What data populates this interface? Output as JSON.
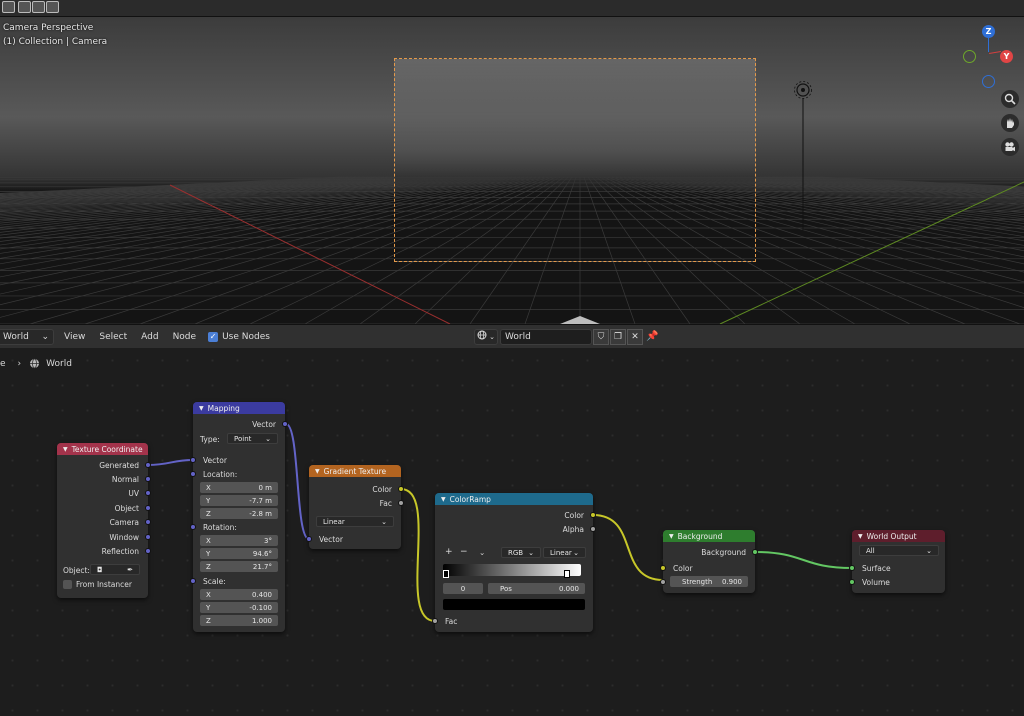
{
  "viewport": {
    "overlay_line1": "Camera Perspective",
    "overlay_line2": "(1) Collection | Camera",
    "gizmo": {
      "z": "Z",
      "y": "Y"
    }
  },
  "node_header": {
    "editor_type": "World",
    "menu": [
      "View",
      "Select",
      "Add",
      "Node"
    ],
    "use_nodes_label": "Use Nodes",
    "use_nodes_checked": true,
    "datablock_name": "World"
  },
  "breadcrumb": {
    "prefix": "e",
    "current": "World"
  },
  "nodes": {
    "texcoord": {
      "title": "Texture Coordinate",
      "outputs": [
        "Generated",
        "Normal",
        "UV",
        "Object",
        "Camera",
        "Window",
        "Reflection"
      ],
      "object_label": "Object:",
      "from_instancer": "From Instancer"
    },
    "mapping": {
      "title": "Mapping",
      "output": "Vector",
      "type_label": "Type:",
      "type_value": "Point",
      "vector_input": "Vector",
      "location_label": "Location:",
      "location": [
        {
          "axis": "X",
          "value": "0 m"
        },
        {
          "axis": "Y",
          "value": "-7.7 m"
        },
        {
          "axis": "Z",
          "value": "-2.8 m"
        }
      ],
      "rotation_label": "Rotation:",
      "rotation": [
        {
          "axis": "X",
          "value": "3°"
        },
        {
          "axis": "Y",
          "value": "94.6°"
        },
        {
          "axis": "Z",
          "value": "21.7°"
        }
      ],
      "scale_label": "Scale:",
      "scale": [
        {
          "axis": "X",
          "value": "0.400"
        },
        {
          "axis": "Y",
          "value": "-0.100"
        },
        {
          "axis": "Z",
          "value": "1.000"
        }
      ]
    },
    "gradient": {
      "title": "Gradient Texture",
      "out_color": "Color",
      "out_fac": "Fac",
      "type_value": "Linear",
      "input": "Vector"
    },
    "colorramp": {
      "title": "ColorRamp",
      "out_color": "Color",
      "out_alpha": "Alpha",
      "add": "+",
      "remove": "−",
      "color_mode": "RGB",
      "interpolation": "Linear",
      "stop_index": "0",
      "pos_label": "Pos",
      "pos_value": "0.000",
      "input": "Fac"
    },
    "background": {
      "title": "Background",
      "output": "Background",
      "in_color": "Color",
      "strength_label": "Strength",
      "strength_value": "0.900"
    },
    "output": {
      "title": "World Output",
      "target": "All",
      "in_surface": "Surface",
      "in_volume": "Volume"
    }
  },
  "colors": {
    "texcoord_header": "#a3334b",
    "mapping_header": "#3b3ba0",
    "gradient_header": "#b36420",
    "colorramp_header": "#1e6a8c",
    "background_header": "#2e7d2e",
    "output_header": "#5e1e2c",
    "camera_frame": "#e59a4a",
    "vector_socket": "#6363c7",
    "color_socket": "#c7c729",
    "shader_socket": "#63c763"
  }
}
